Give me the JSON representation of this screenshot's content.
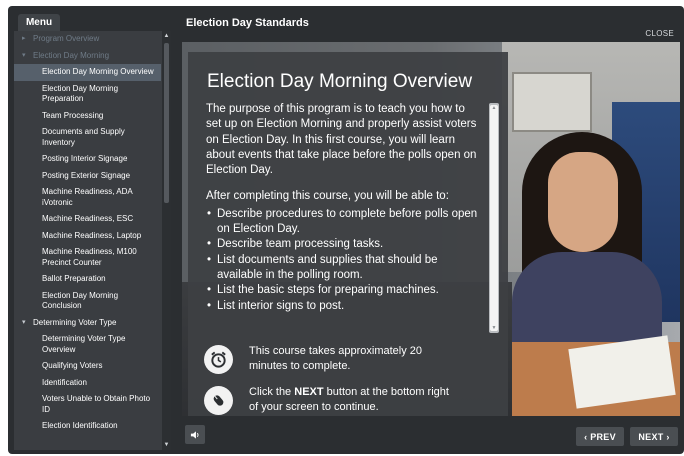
{
  "menu_tab": "Menu",
  "course_title": "Election Day Standards",
  "close_label": "CLOSE",
  "menu": [
    {
      "label": "Program Overview",
      "level": 0,
      "arrow": "▸",
      "dim": true
    },
    {
      "label": "Election Day Morning",
      "level": 0,
      "arrow": "▾",
      "dim": true
    },
    {
      "label": "Election Day Morning Overview",
      "level": 1,
      "active": true
    },
    {
      "label": "Election Day Morning Preparation",
      "level": 1
    },
    {
      "label": "Team Processing",
      "level": 1
    },
    {
      "label": "Documents and Supply Inventory",
      "level": 1
    },
    {
      "label": "Posting Interior Signage",
      "level": 1
    },
    {
      "label": "Posting Exterior Signage",
      "level": 1
    },
    {
      "label": "Machine Readiness, ADA iVotronic",
      "level": 1
    },
    {
      "label": "Machine Readiness, ESC",
      "level": 1
    },
    {
      "label": "Machine Readiness, Laptop",
      "level": 1
    },
    {
      "label": "Machine Readiness, M100 Precinct Counter",
      "level": 1
    },
    {
      "label": "Ballot Preparation",
      "level": 1
    },
    {
      "label": "Election Day Morning Conclusion",
      "level": 1
    },
    {
      "label": "Determining Voter Type",
      "level": 0,
      "arrow": "▾"
    },
    {
      "label": "Determining Voter Type Overview",
      "level": 1
    },
    {
      "label": "Qualifying Voters",
      "level": 1
    },
    {
      "label": "Identification",
      "level": 1
    },
    {
      "label": "Voters Unable to Obtain Photo ID",
      "level": 1
    },
    {
      "label": "Election Identification",
      "level": 1
    }
  ],
  "slide": {
    "title": "Election Day Morning Overview",
    "intro": "The purpose of this program is to teach you how to set up on Election Morning and properly assist voters on Election Day. In this first course, you will learn about events that take place before the polls open on Election Day.",
    "objectives_lead": "After completing this course, you will be able to:",
    "objectives": [
      "Describe procedures to complete before polls open on Election Day.",
      "Describe team processing tasks.",
      "List documents and supplies that should be available in the polling room.",
      "List the basic steps for preparing machines.",
      "List interior signs to post."
    ],
    "time_note": "This course takes approximately 20 minutes to complete.",
    "next_note_pre": "Click the ",
    "next_note_bold": "NEXT",
    "next_note_post": " button at the bottom right of your screen to continue."
  },
  "nav": {
    "prev_label": "‹ PREV",
    "next_label": "NEXT ›"
  }
}
